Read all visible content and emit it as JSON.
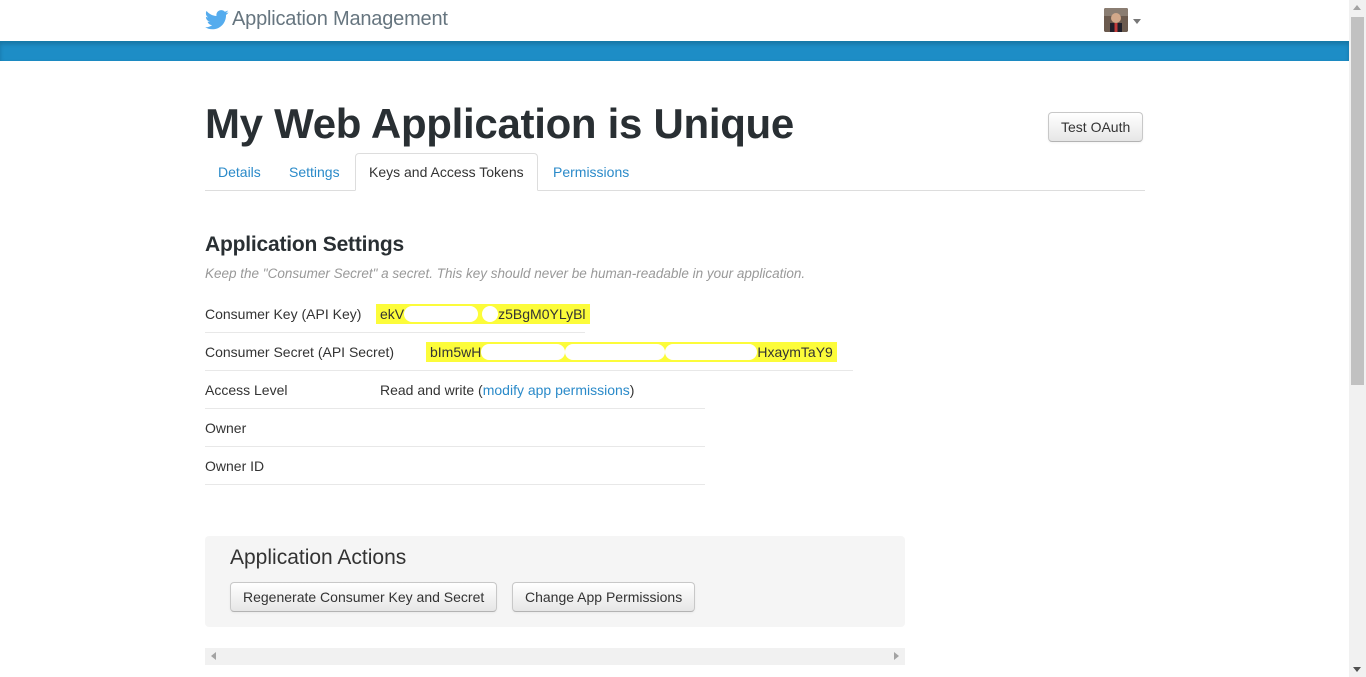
{
  "header": {
    "brand_title": "Application Management",
    "logo_icon": "twitter-bird-icon",
    "accent_color": "#1d8dc6",
    "logo_color": "#55acee"
  },
  "page": {
    "title": "My Web Application is Unique",
    "test_oauth_label": "Test OAuth"
  },
  "tabs": [
    {
      "label": "Details",
      "active": false
    },
    {
      "label": "Settings",
      "active": false
    },
    {
      "label": "Keys and Access Tokens",
      "active": true
    },
    {
      "label": "Permissions",
      "active": false
    }
  ],
  "settings": {
    "title": "Application Settings",
    "hint": "Keep the \"Consumer Secret\" a secret. This key should never be human-readable in your application.",
    "consumer_key_label": "Consumer Key (API Key)",
    "consumer_key_start": "ekV",
    "consumer_key_end": "z5BgM0YLyBl",
    "consumer_secret_label": "Consumer Secret (API Secret)",
    "consumer_secret_start": "bIm5wH",
    "consumer_secret_end": "HxaymTaY9",
    "access_level_label": "Access Level",
    "access_level_value": "Read and write (",
    "access_level_link": "modify app permissions",
    "access_level_close": ")",
    "owner_label": "Owner",
    "owner_id_label": "Owner ID",
    "highlight_color": "#fcfc3a"
  },
  "actions": {
    "title": "Application Actions",
    "regenerate_label": "Regenerate Consumer Key and Secret",
    "change_permissions_label": "Change App Permissions"
  }
}
